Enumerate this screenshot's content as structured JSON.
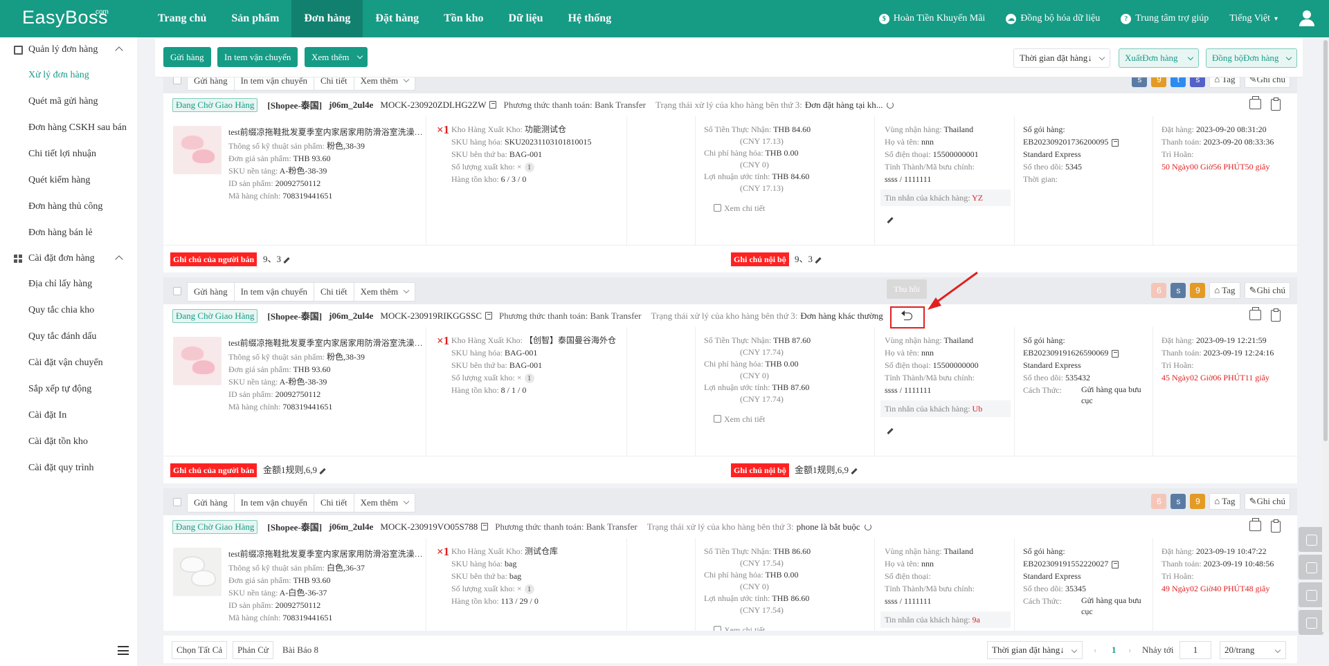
{
  "app": {
    "logo": "EasyBoss",
    "logo_sup": "com"
  },
  "nav": [
    "Trang chủ",
    "Sản phẩm",
    "Đơn hàng",
    "Đặt hàng",
    "Tồn kho",
    "Dữ liệu",
    "Hệ thống"
  ],
  "header_right": {
    "promo": "Hoàn Tiền Khuyến Mãi",
    "sync": "Đồng bộ hóa dữ liệu",
    "help": "Trung tâm trợ giúp",
    "lang": "Tiếng Việt"
  },
  "sidebar": {
    "group1": "Quản lý đơn hàng",
    "items1": [
      "Xử lý đơn hàng",
      "Quét mã gửi hàng",
      "Đơn hàng CSKH sau bán",
      "Chi tiết lợi nhuận",
      "Quét kiểm hàng",
      "Đơn hàng thủ công",
      "Đơn hàng bán lẻ"
    ],
    "group2": "Cài đặt đơn hàng",
    "items2": [
      "Địa chỉ lấy hàng",
      "Quy tắc chia kho",
      "Quy tắc đánh dấu",
      "Cài đặt vận chuyển",
      "Sắp xếp tự động",
      "Cài đặt In",
      "Cài đặt tồn kho",
      "Cài đặt quy trình"
    ]
  },
  "toolbar": {
    "send": "Gửi hàng",
    "print": "In tem vận chuyển",
    "more": "Xem thêm",
    "sort": "Thời gian đặt hàng↓",
    "export": "XuấtĐơn hàng",
    "syncorder": "Đồng bộĐơn hàng"
  },
  "rowbtns": {
    "send": "Gửi hàng",
    "print": "In tem vận chuyển",
    "detail": "Chi tiết",
    "more": "Xem thêm",
    "tag": "Tag",
    "note": "Ghi chú"
  },
  "labels": {
    "status": "Đang Chờ Giao Hàng",
    "pay": "Phương thức thanh toán: Bank Transfer",
    "st3": "Trạng thái xử lý của kho hàng bên thứ 3:",
    "spec": "Thông số kỹ thuật sản phẩm:",
    "unit": "Đơn giá sản phẩm:",
    "psku": "SKU nền tảng:",
    "pid": "ID sản phẩm:",
    "main": "Mã hàng chính:",
    "wh": "Kho Hàng Xuất Kho:",
    "sku": "SKU hàng hóa:",
    "sku3": "SKU bên thứ ba:",
    "outq": "Số lượng xuất kho:",
    "stock": "Hàng tồn kho:",
    "recv": "Số Tiền Thực Nhận:",
    "fee": "Chi phí hàng hóa:",
    "profit": "Lợi nhuận ước tính:",
    "view": "Xem chi tiết",
    "region": "Vùng nhận hàng:",
    "name": "Họ và tên:",
    "phone": "Số điện thoại:",
    "prov": "Tỉnh Thành/Mã bưu chính:",
    "msg": "Tin nhắn của khách hàng:",
    "pkg": "Số gói hàng:",
    "track": "Số theo dõi:",
    "time": "Thời gian:",
    "method": "Cách Thức:",
    "ordered": "Đặt hàng:",
    "paid": "Thanh toán:",
    "delay": "Trì Hoãn:",
    "seller_note": "Ghi chú của người bán",
    "internal_note": "Ghi chú nội bộ",
    "tooltip": "Thu hồi"
  },
  "orders": [
    {
      "shop": "[Shopee-泰国]",
      "acc": "j06m_2ul4e",
      "id": "MOCK-230920ZDLHG2ZW",
      "st3v": "Đơn đặt hàng tại kh...",
      "pname": "test前缀凉拖鞋批发夏季室内家居家用防滑浴室洗澡情侣eva拖鞋",
      "qty": "×1",
      "spec": "粉色,38-39",
      "unit": "THB 93.60",
      "psku": "A-粉色-38-39",
      "pid": "20092750112",
      "main": "708319441651",
      "wh": "功能测试仓",
      "sku": "SKU20231103101810015",
      "sku3": "BAG-001",
      "outq": "×",
      "outc": "1",
      "stock": "6 / 3 / 0",
      "recv": "THB 84.60",
      "recv_c": "(CNY 17.13)",
      "fee": "THB 0.00",
      "fee_c": "(CNY 0)",
      "profit": "THB 84.60",
      "profit_c": "(CNY 17.13)",
      "region": "Thailand",
      "name": "nnn",
      "phone": "15500000001",
      "prov": "ssss / 1111111",
      "msg": "YZ",
      "pkg": "EB202309201736200095",
      "ship": "Standard Express",
      "track": "5345",
      "extra_l": "Thời gian:",
      "extra_v": "",
      "ordered": "2023-09-20 08:31:20",
      "paid": "2023-09-20 08:33:36",
      "delay": "50 Ngày00 Giờ56 PHÚT50 giây",
      "snote": "9、3",
      "inote": "9、3",
      "badges": [
        "s",
        "9",
        "t",
        "s"
      ]
    },
    {
      "shop": "[Shopee-泰国]",
      "acc": "j06m_2ul4e",
      "id": "MOCK-230919RIKGGSSC",
      "st3v": "Đơn hàng khác thường",
      "pname": "test前缀凉拖鞋批发夏季室内家居家用防滑浴室洗澡情侣eva拖鞋",
      "qty": "×1",
      "spec": "粉色,38-39",
      "unit": "THB 93.60",
      "psku": "A-粉色-38-39",
      "pid": "20092750112",
      "main": "708319441651",
      "wh": "【创智】泰国曼谷海外仓",
      "sku": "BAG-001",
      "sku3": "BAG-001",
      "outq": "×",
      "outc": "1",
      "stock": "8 / 1 / 0",
      "recv": "THB 87.60",
      "recv_c": "(CNY 17.74)",
      "fee": "THB 0.00",
      "fee_c": "(CNY 0)",
      "profit": "THB 87.60",
      "profit_c": "(CNY 17.74)",
      "region": "Thailand",
      "name": "nnn",
      "phone": "15500000000",
      "prov": "ssss / 1111111",
      "msg": "Ub",
      "pkg": "EB202309191626590069",
      "ship": "Standard Express",
      "track": "535432",
      "extra_l": "Cách Thức:",
      "extra_v": "Gửi hàng qua bưu cục",
      "ordered": "2023-09-19 12:21:59",
      "paid": "2023-09-19 12:24:16",
      "delay": "45 Ngày02 Giờ06 PHÚT11 giây",
      "snote": "金额1规则,6,9",
      "inote": "金额1规则,6,9",
      "badges": [
        "6",
        "s",
        "9"
      ]
    },
    {
      "shop": "[Shopee-泰国]",
      "acc": "j06m_2ul4e",
      "id": "MOCK-230919VO05S788",
      "st3v": "phone là bắt buộc",
      "pname": "test前缀凉拖鞋批发夏季室内家居家用防滑浴室洗澡情侣eva拖鞋",
      "qty": "×1",
      "spec": "白色,36-37",
      "unit": "THB 93.60",
      "psku": "A-白色-36-37",
      "pid": "20092750112",
      "main": "708319441651",
      "wh": "测试仓库",
      "sku": "bag",
      "sku3": "bag",
      "outq": "×",
      "outc": "1",
      "stock": "113 / 29 / 0",
      "recv": "THB 86.60",
      "recv_c": "(CNY 17.54)",
      "fee": "THB 0.00",
      "fee_c": "(CNY 0)",
      "profit": "THB 86.60",
      "profit_c": "(CNY 17.54)",
      "region": "Thailand",
      "name": "nnn",
      "phone": "",
      "prov": "ssss / 1111111",
      "msg": "9a",
      "pkg": "EB202309191552220027",
      "ship": "Standard Express",
      "track": "35345",
      "extra_l": "Cách Thức:",
      "extra_v": "Gửi hàng qua bưu cục",
      "ordered": "2023-09-19 10:47:22",
      "paid": "2023-09-19 10:48:56",
      "delay": "49 Ngày02 Giờ40 PHÚT48 giây",
      "snote": "",
      "inote": "",
      "badges": [
        "6",
        "s",
        "9"
      ]
    }
  ],
  "footer": {
    "selall": "Chọn Tất Cả",
    "invert": "Phản Cử",
    "count": "Bài Báo 8",
    "sort": "Thời gian đặt hàng↓",
    "page": "1",
    "jump": "Nhảy tới",
    "jumpv": "1",
    "size": "20/trang"
  }
}
